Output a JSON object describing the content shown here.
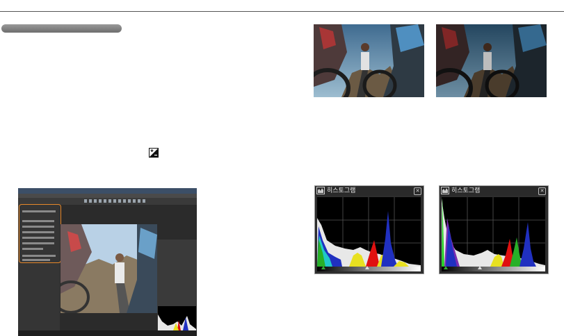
{
  "colors": {
    "rule": "#555555",
    "pill": "#8a8a8a",
    "highlight": "#e8892a"
  },
  "histograms": {
    "left": {
      "title": "히스토그램",
      "close": "✕"
    },
    "right": {
      "title": "히스토그램",
      "close": "✕"
    }
  },
  "icons": [
    "exposure-compensation-icon",
    "histogram-icon",
    "close-icon"
  ]
}
